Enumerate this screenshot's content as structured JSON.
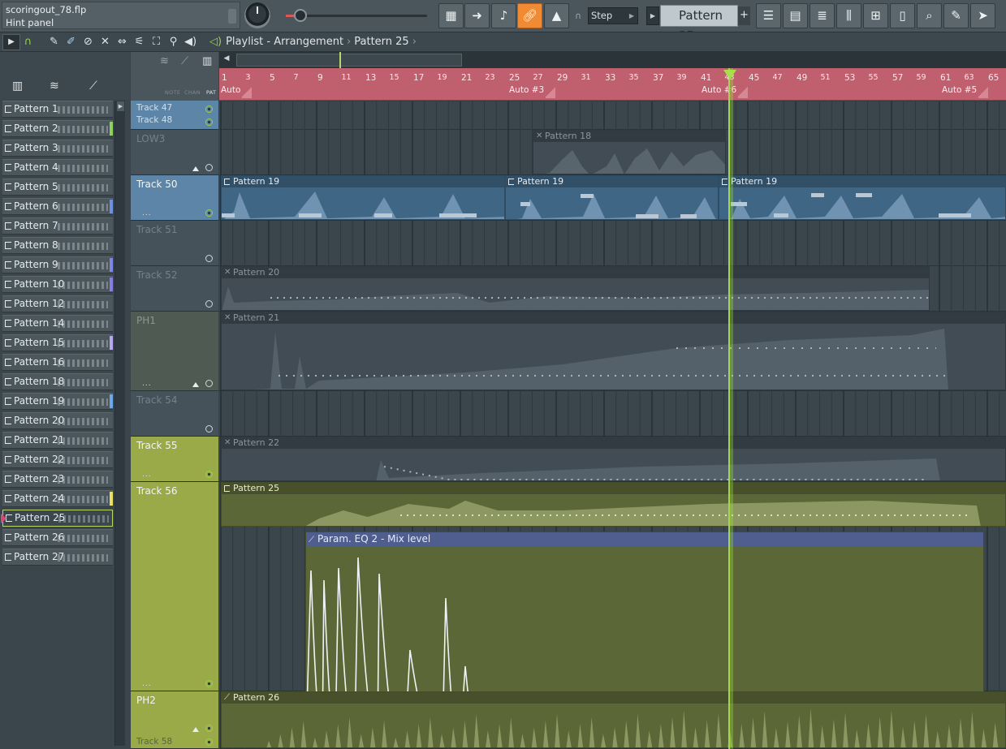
{
  "hint": {
    "project": "scoringout_78.flp",
    "panel": "Hint panel"
  },
  "toolbar": {
    "step_mode": "Step",
    "pattern_selector": "Pattern 25",
    "plus": "+"
  },
  "breadcrumb": {
    "window": "Playlist - Arrangement",
    "pattern": "Pattern 25"
  },
  "browser": {
    "patterns": [
      {
        "label": "Pattern 1",
        "stripe": ""
      },
      {
        "label": "Pattern 2",
        "stripe": "#8fd060"
      },
      {
        "label": "Pattern 3",
        "stripe": ""
      },
      {
        "label": "Pattern 4",
        "stripe": ""
      },
      {
        "label": "Pattern 5",
        "stripe": ""
      },
      {
        "label": "Pattern 6",
        "stripe": "#6f8fe0"
      },
      {
        "label": "Pattern 7",
        "stripe": ""
      },
      {
        "label": "Pattern 8",
        "stripe": ""
      },
      {
        "label": "Pattern 9",
        "stripe": "#7e86e6"
      },
      {
        "label": "Pattern 10",
        "stripe": "#8a7ce0"
      },
      {
        "label": "Pattern 12",
        "stripe": ""
      },
      {
        "label": "Pattern 14",
        "stripe": ""
      },
      {
        "label": "Pattern 15",
        "stripe": "#b7a6f0"
      },
      {
        "label": "Pattern 16",
        "stripe": ""
      },
      {
        "label": "Pattern 18",
        "stripe": ""
      },
      {
        "label": "Pattern 19",
        "stripe": "#6fa8e8"
      },
      {
        "label": "Pattern 20",
        "stripe": ""
      },
      {
        "label": "Pattern 21",
        "stripe": ""
      },
      {
        "label": "Pattern 22",
        "stripe": ""
      },
      {
        "label": "Pattern 23",
        "stripe": ""
      },
      {
        "label": "Pattern 24",
        "stripe": "#e8e060"
      },
      {
        "label": "Pattern 25",
        "stripe": ""
      },
      {
        "label": "Pattern 26",
        "stripe": ""
      },
      {
        "label": "Pattern 27",
        "stripe": ""
      }
    ]
  },
  "track_header_modes": [
    "NOTE",
    "CHAN",
    "PAT"
  ],
  "tracks": {
    "t47": "Track 47",
    "t48": "Track 48",
    "low3": "LOW3",
    "t50": "Track 50",
    "t51": "Track 51",
    "t52": "Track 52",
    "ph1": "PH1",
    "t54": "Track 54",
    "t55": "Track 55",
    "t56": "Track 56",
    "ph2": "PH2",
    "t58": "Track 58"
  },
  "ruler": {
    "bars": [
      "1",
      "3",
      "5",
      "7",
      "9",
      "11",
      "13",
      "15",
      "17",
      "19",
      "21",
      "23",
      "25",
      "27",
      "29",
      "31",
      "33",
      "35",
      "37",
      "39",
      "41",
      "43",
      "45",
      "47",
      "49",
      "51",
      "53",
      "55",
      "57",
      "59",
      "61",
      "63",
      "65"
    ],
    "autos": [
      "Auto",
      "Auto #3",
      "Auto #6",
      "Auto #5"
    ],
    "current_bar": 43
  },
  "clips": {
    "p18": "Pattern 18",
    "p19a": "Pattern 19",
    "p19b": "Pattern 19",
    "p19c": "Pattern 19",
    "p20": "Pattern 20",
    "p21": "Pattern 21",
    "p22": "Pattern 22",
    "p25": "Pattern 25",
    "eq": "Param. EQ 2 - Mix level",
    "p26": "Pattern 26"
  },
  "colors": {
    "accent_orange": "#f08a33",
    "playhead_green": "#9fd84a",
    "ruler_red": "#c0606e",
    "track_blue": "#5c85a8",
    "track_olive": "#9aaa48",
    "automation_blue": "#4f5e8e"
  },
  "icons": [
    "typing-keyboard-icon",
    "arrow-right-icon",
    "step-icon",
    "link-icon",
    "hat-icon",
    "metronome-icon",
    "mixer-icon",
    "piano-roll-icon",
    "browser-icon",
    "plugin-icon",
    "channel-rack-icon",
    "help-icon"
  ]
}
